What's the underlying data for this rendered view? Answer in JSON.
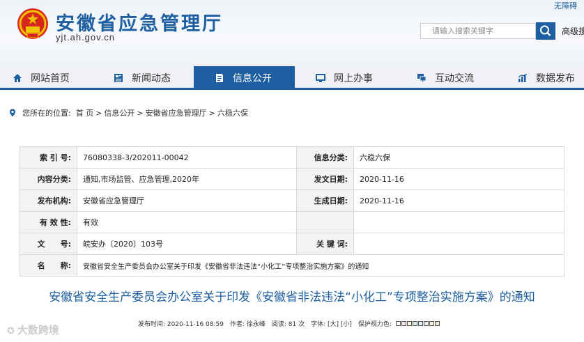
{
  "header": {
    "site_title": "安徽省应急管理厅",
    "domain": "yjt.ah.gov.cn",
    "accessibility": "无障碍",
    "search_placeholder": "请输入搜索关键字",
    "advanced_search": "高级搜"
  },
  "nav": {
    "items": [
      {
        "label": "网站首页",
        "icon": "home-icon"
      },
      {
        "label": "新闻动态",
        "icon": "news-icon"
      },
      {
        "label": "信息公开",
        "icon": "document-icon"
      },
      {
        "label": "网上办事",
        "icon": "monitor-icon"
      },
      {
        "label": "互动交流",
        "icon": "chat-icon"
      },
      {
        "label": "数据发布",
        "icon": "chart-icon"
      }
    ],
    "active": "信息公开"
  },
  "breadcrumb": {
    "prefix": "您所在的位置:",
    "items": [
      "首 页",
      "信息公开",
      "安徽省应急管理厅",
      "六稳六保"
    ]
  },
  "meta": {
    "index_label": "索 引 号:",
    "index_value": "76080338-3/202011-00042",
    "category_label": "信息分类:",
    "category_value": "六稳六保",
    "content_label": "内容分类:",
    "content_value": "通知,市场监管、应急管理,2020年",
    "issue_date_label": "发文日期:",
    "issue_date_value": "2020-11-16",
    "org_label": "发布机构:",
    "org_value": "安徽省应急管理厅",
    "gen_date_label": "生成日期:",
    "gen_date_value": "2020-11-16",
    "validity_label": "有 效 性:",
    "validity_value": "有效",
    "docno_label": "文　　号:",
    "docno_value": "皖安办〔2020〕103号",
    "keywords_label": "关 键 词:",
    "keywords_value": "",
    "name_label": "名　　称:",
    "name_value": "安徽省安全生产委员会办公室关于印发《安徽省非法违法“小化工”专项整治实施方案》的通知"
  },
  "document": {
    "title": "安徽省安全生产委员会办公室关于印发《安徽省非法违法“小化工”专项整治实施方案》的通知",
    "info": "发布时间: 2020-11-16 08:59　作者: 徐永峰　阅读: 81 次　字体: [大] [小]　保护视力色:"
  },
  "watermark": "大数跨境",
  "colors": {
    "brand": "#1d5fa0"
  }
}
